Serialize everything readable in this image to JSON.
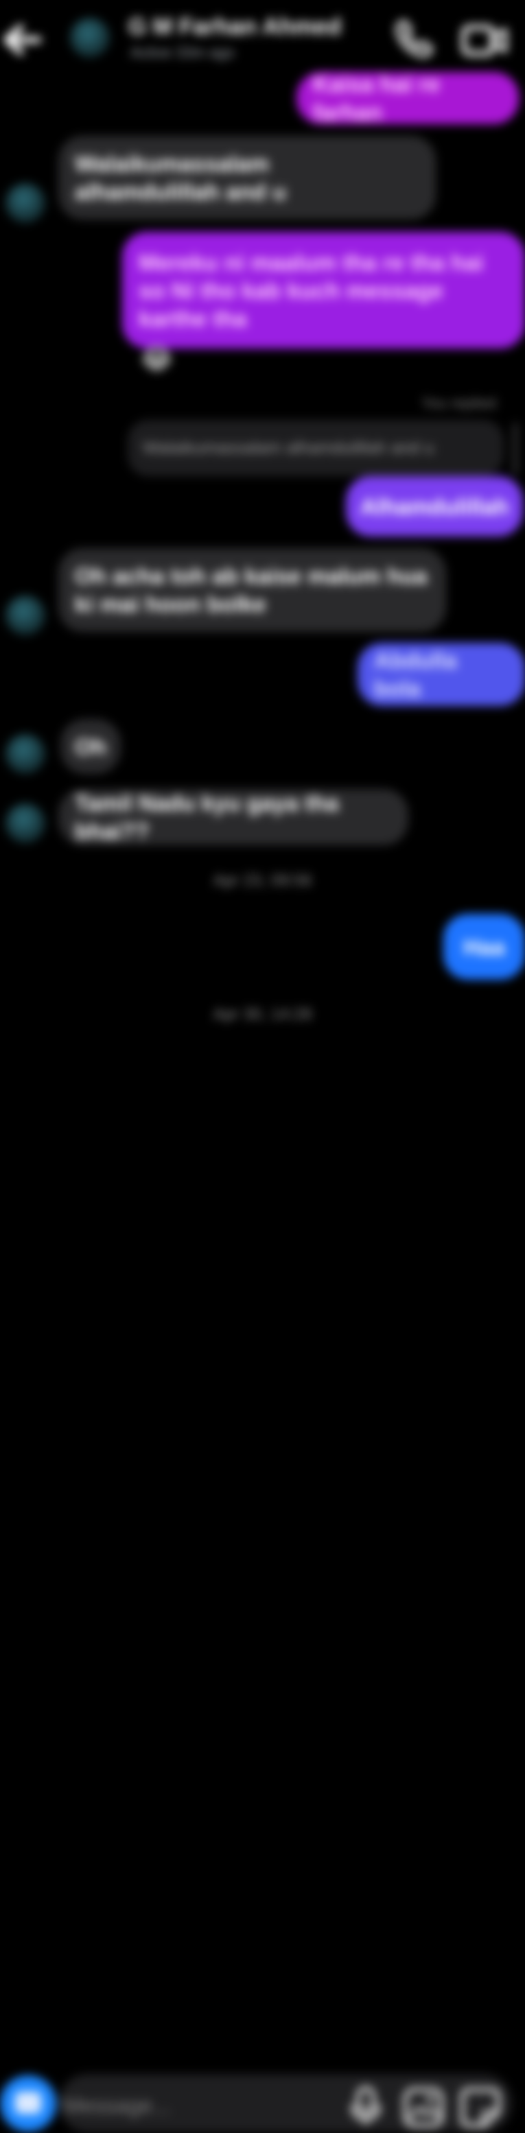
{
  "header": {
    "contact_name": "G M Farhan Ahmed",
    "status": "Active 33m ago",
    "back_icon": "arrow-left-icon",
    "call_icon": "phone-icon",
    "video_icon": "video-camera-icon"
  },
  "messages": [
    {
      "id": "m1",
      "direction": "outgoing",
      "text": "Kaisa hai re farhan"
    },
    {
      "id": "m2",
      "direction": "incoming",
      "text": "Walaikumassalam alhamdulillah and u"
    },
    {
      "id": "m3",
      "direction": "outgoing",
      "text": "Mereku ni maalum tha re tha hai so Ni tho kab kuch message karthe tha"
    },
    {
      "id": "m3_reaction",
      "text": "😂"
    },
    {
      "id": "m4_reply_label",
      "text": "You replied"
    },
    {
      "id": "m4_quote",
      "text": "Walaikumassalam alhamdulillah and u"
    },
    {
      "id": "m4",
      "direction": "outgoing",
      "text": "Alhamdulillah"
    },
    {
      "id": "m5",
      "direction": "incoming",
      "text": "Oh acha toh ab kaise malum hua ki mai hoon bolke"
    },
    {
      "id": "m6",
      "direction": "outgoing",
      "text": "Abdulla bola"
    },
    {
      "id": "m7",
      "direction": "incoming",
      "text": "Oh"
    },
    {
      "id": "m8",
      "direction": "incoming",
      "text": "Tamil Nadu kyu gaya tha bhai??"
    },
    {
      "id": "t1",
      "text": "Apr 23, 09:56"
    },
    {
      "id": "m9",
      "direction": "outgoing",
      "text": "Haa"
    },
    {
      "id": "t2",
      "text": "Apr 30, 14:28"
    }
  ],
  "composer": {
    "placeholder": "Message...",
    "camera_icon": "camera-icon",
    "mic_icon": "microphone-icon",
    "gallery_icon": "image-icon",
    "sticker_icon": "sticker-icon"
  },
  "colors": {
    "background": "#000000",
    "incoming_bubble": "#2a2a2c",
    "outgoing_purple": "#a817d4",
    "outgoing_violet": "#7b3ff0",
    "outgoing_indigo": "#5156ec",
    "outgoing_blue": "#1e74ff"
  }
}
